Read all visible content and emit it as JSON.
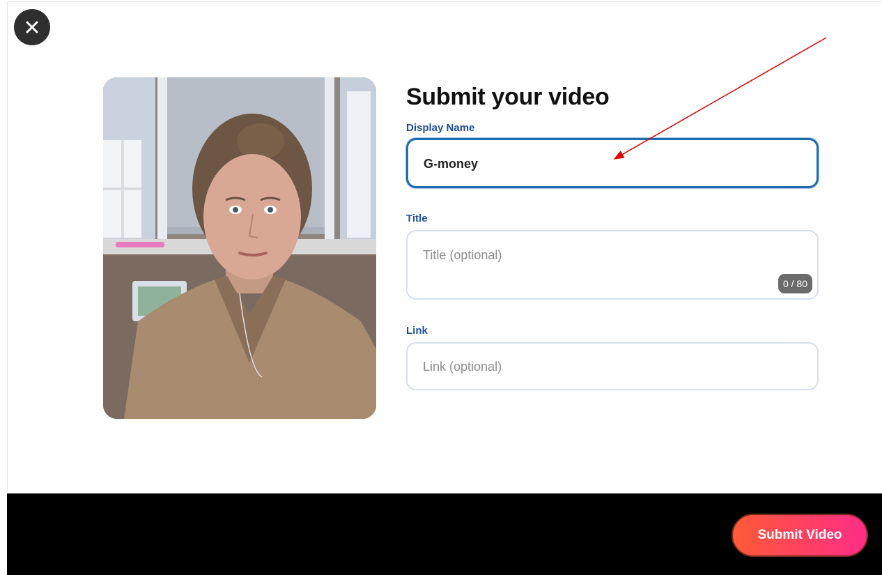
{
  "header": {
    "close_icon": "close-icon"
  },
  "form": {
    "title": "Submit your video",
    "display_name": {
      "label": "Display Name",
      "value": "G-money"
    },
    "title_field": {
      "label": "Title",
      "placeholder": "Title (optional)",
      "counter": "0 / 80"
    },
    "link_field": {
      "label": "Link",
      "placeholder": "Link (optional)"
    }
  },
  "footer": {
    "submit_label": "Submit Video"
  },
  "colors": {
    "label_blue": "#1f4e9c",
    "active_border": "#1e6bb0",
    "submit_gradient_start": "#ff5a36",
    "submit_gradient_end": "#ff2e86",
    "annotation_arrow": "#e00000"
  }
}
